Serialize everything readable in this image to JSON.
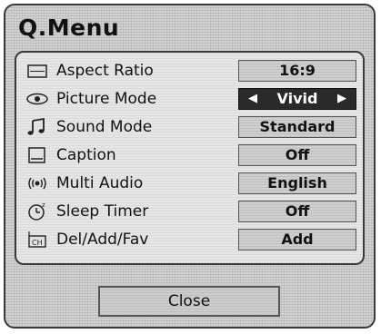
{
  "menu": {
    "title": "Q.Menu",
    "items": [
      {
        "label": "Aspect Ratio",
        "value": "16:9",
        "icon": "aspect-ratio-icon",
        "selected": false
      },
      {
        "label": "Picture Mode",
        "value": "Vivid",
        "icon": "eye-icon",
        "selected": true
      },
      {
        "label": "Sound Mode",
        "value": "Standard",
        "icon": "music-note-icon",
        "selected": false
      },
      {
        "label": "Caption",
        "value": "Off",
        "icon": "caption-icon",
        "selected": false
      },
      {
        "label": "Multi Audio",
        "value": "English",
        "icon": "audio-waves-icon",
        "selected": false
      },
      {
        "label": "Sleep Timer",
        "value": "Off",
        "icon": "timer-icon",
        "selected": false
      },
      {
        "label": "Del/Add/Fav",
        "value": "Add",
        "icon": "channel-icon",
        "selected": false
      }
    ],
    "close_label": "Close"
  }
}
